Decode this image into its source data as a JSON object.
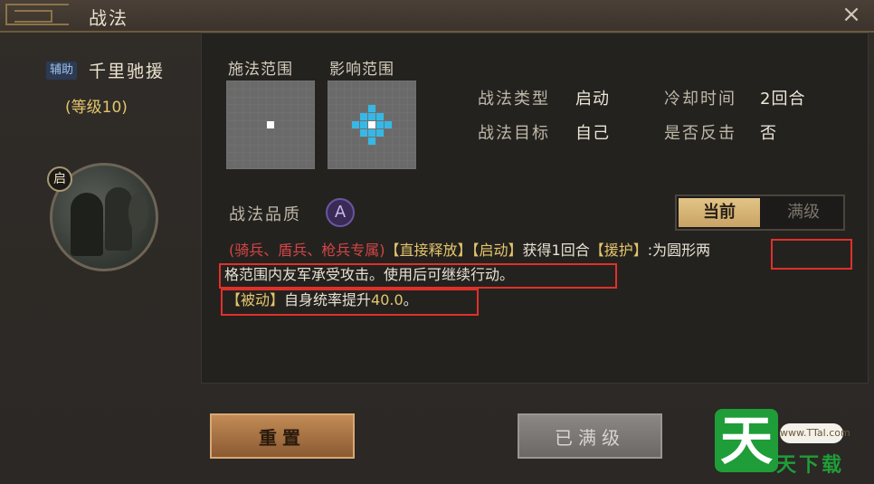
{
  "window": {
    "title": "战法",
    "close_icon": "×"
  },
  "tactic": {
    "tag": "辅助",
    "name": "千里驰援",
    "level": "(等级10)",
    "start_badge": "启"
  },
  "grids": {
    "cast_range_label": "施法范围",
    "effect_range_label": "影响范围"
  },
  "info": {
    "type_label": "战法类型",
    "type_value": "启动",
    "cooldown_label": "冷却时间",
    "cooldown_value": "2回合",
    "target_label": "战法目标",
    "target_value": "自己",
    "counter_label": "是否反击",
    "counter_value": "否"
  },
  "quality": {
    "label": "战法品质",
    "grade": "A"
  },
  "toggle": {
    "current": "当前",
    "max": "满级"
  },
  "description": {
    "troops": "(骑兵、盾兵、枪兵专属)",
    "direct": "【直接释放】",
    "start": "【启动】",
    "gain": "获得1回合",
    "assist": "【援护】",
    "colon": ":",
    "line1_end": "为圆形两",
    "line2": "格范围内友军承受攻击。使用后可继续行动。",
    "passive": "【被动】",
    "line3_mid": "自身统率提升",
    "line3_value": "40.0",
    "line3_end": "。"
  },
  "buttons": {
    "reset": "重置",
    "maxed": "已满级"
  },
  "watermark": {
    "glyph": "天",
    "url": "www.TTal.com",
    "text": "天下载"
  }
}
